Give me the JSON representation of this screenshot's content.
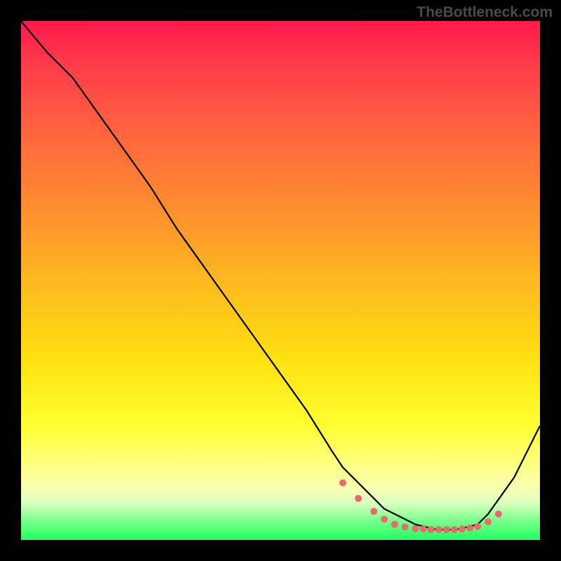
{
  "watermark": "TheBottleneck.com",
  "chart_data": {
    "type": "line",
    "title": "",
    "xlabel": "",
    "ylabel": "",
    "xlim": [
      0,
      100
    ],
    "ylim": [
      0,
      100
    ],
    "grid": false,
    "series": [
      {
        "name": "curve",
        "x": [
          0,
          5,
          10,
          15,
          20,
          25,
          30,
          35,
          40,
          45,
          50,
          55,
          60,
          62,
          65,
          68,
          70,
          72,
          74,
          76,
          78,
          80,
          82,
          84,
          86,
          88,
          90,
          95,
          100
        ],
        "y": [
          100,
          94,
          89,
          82,
          75,
          68,
          60,
          53,
          46,
          39,
          32,
          25,
          17,
          14,
          11,
          8,
          6,
          5,
          4,
          3,
          2.5,
          2,
          2,
          2,
          2.5,
          3,
          5,
          12,
          22
        ]
      }
    ],
    "markers": {
      "name": "dots",
      "color": "#e86a6a",
      "x": [
        62,
        65,
        68,
        70,
        72,
        74,
        76,
        77.5,
        79,
        80.5,
        82,
        83.5,
        85,
        86.5,
        88,
        90,
        92
      ],
      "y": [
        11,
        8,
        5.5,
        4,
        3,
        2.5,
        2.2,
        2.1,
        2,
        2,
        2,
        2,
        2.1,
        2.3,
        2.6,
        3.5,
        5
      ]
    }
  }
}
